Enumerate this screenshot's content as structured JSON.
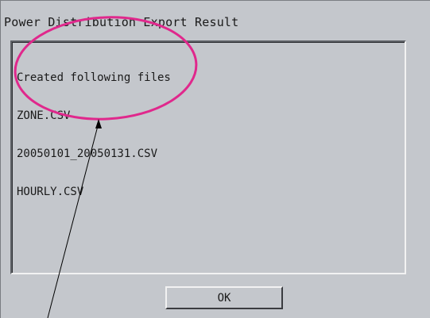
{
  "window": {
    "title": "Power Distribution Export Result"
  },
  "output": {
    "lines": [
      "Created following files",
      "ZONE.CSV",
      "20050101_20050131.CSV",
      "HOURLY.CSV"
    ]
  },
  "buttons": {
    "ok_label": "OK"
  },
  "colors": {
    "annotation_ellipse": "#e0288c",
    "annotation_arrow": "#000000",
    "window_background": "#c4c7cc"
  }
}
